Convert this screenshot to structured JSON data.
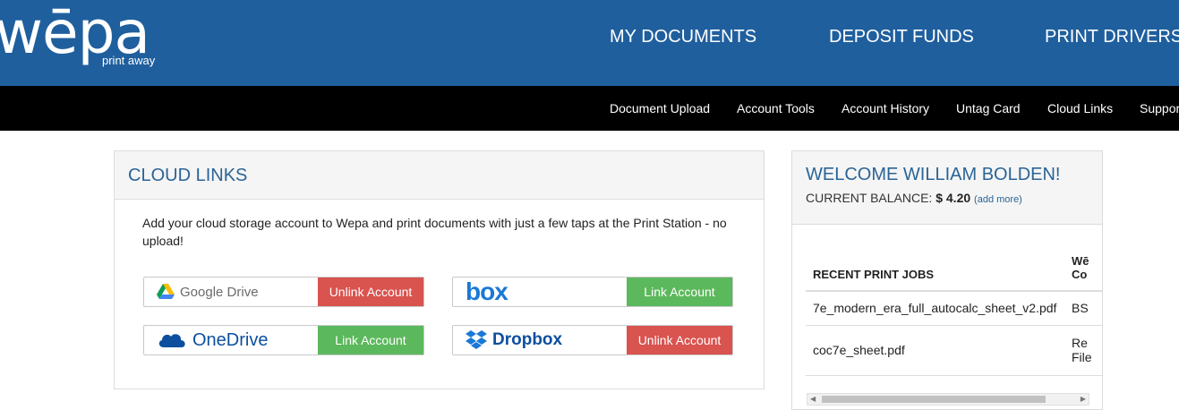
{
  "header": {
    "logo": {
      "word": "wēpa",
      "tagline": "print away"
    },
    "nav": [
      "MY DOCUMENTS",
      "DEPOSIT FUNDS",
      "PRINT DRIVERS"
    ],
    "subnav": [
      "Document Upload",
      "Account Tools",
      "Account History",
      "Untag Card",
      "Cloud Links",
      "Support"
    ]
  },
  "cloud_links": {
    "title": "CLOUD LINKS",
    "description": "Add your cloud storage account to Wepa and print documents with just a few taps at the Print Station - no upload!",
    "services": [
      {
        "name": "Google Drive",
        "icon": "google-drive-icon",
        "button": "Unlink Account",
        "button_color": "#d9534f"
      },
      {
        "name": "box",
        "icon": "box-logo",
        "button": "Link Account",
        "button_color": "#5cb85c"
      },
      {
        "name": "OneDrive",
        "icon": "onedrive-icon",
        "button": "Link Account",
        "button_color": "#5cb85c"
      },
      {
        "name": "Dropbox",
        "icon": "dropbox-icon",
        "button": "Unlink Account",
        "button_color": "#d9534f"
      }
    ]
  },
  "welcome": {
    "title": "WELCOME WILLIAM BOLDEN!",
    "balance_label": "CURRENT BALANCE:",
    "balance_value": "$ 4.20",
    "add_more": "(add more)",
    "jobs_header": "RECENT PRINT JOBS",
    "col2_header_line1": "Wē",
    "col2_header_line2": "Co",
    "jobs": [
      {
        "file": "7e_modern_era_full_autocalc_sheet_v2.pdf",
        "col2": "BS",
        "col2_line2": ""
      },
      {
        "file": "coc7e_sheet.pdf",
        "col2": "Re",
        "col2_line2": "File"
      }
    ]
  },
  "colors": {
    "header_blue": "#1f5f9e",
    "subnav_black": "#000000",
    "title_blue": "#2a6496"
  }
}
